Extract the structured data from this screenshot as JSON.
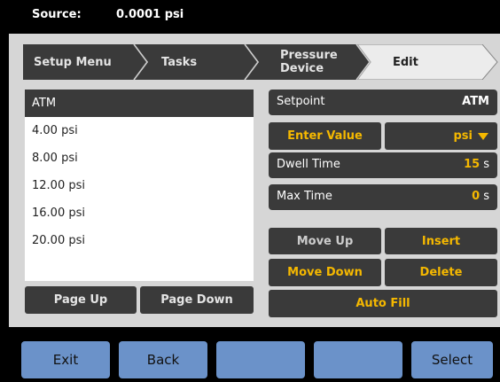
{
  "status": {
    "label": "Source:",
    "value": "0.0001 psi"
  },
  "breadcrumb": {
    "items": [
      {
        "label": "Setup Menu"
      },
      {
        "label": "Tasks"
      },
      {
        "label": "Pressure\nDevice"
      },
      {
        "label": "Edit"
      }
    ]
  },
  "list": {
    "items": [
      "ATM",
      "4.00 psi",
      "8.00 psi",
      "12.00 psi",
      "16.00 psi",
      "20.00 psi"
    ],
    "selected_index": 0,
    "page_up": "Page Up",
    "page_down": "Page Down"
  },
  "setpoint": {
    "label": "Setpoint",
    "value": "ATM"
  },
  "enter_value": {
    "label": "Enter Value",
    "unit": "psi"
  },
  "dwell_time": {
    "label": "Dwell Time",
    "value": "15",
    "unit": "s"
  },
  "max_time": {
    "label": "Max Time",
    "value": "0",
    "unit": "s"
  },
  "actions": {
    "move_up": "Move Up",
    "insert": "Insert",
    "move_down": "Move Down",
    "delete": "Delete",
    "auto_fill": "Auto Fill"
  },
  "softkeys": [
    "Exit",
    "Back",
    "",
    "",
    "Select"
  ],
  "colors": {
    "accent_yellow": "#f5b800",
    "panel_dark": "#3a3a3a",
    "softkey_blue": "#6b92c9",
    "background_gray": "#d6d6d6"
  }
}
